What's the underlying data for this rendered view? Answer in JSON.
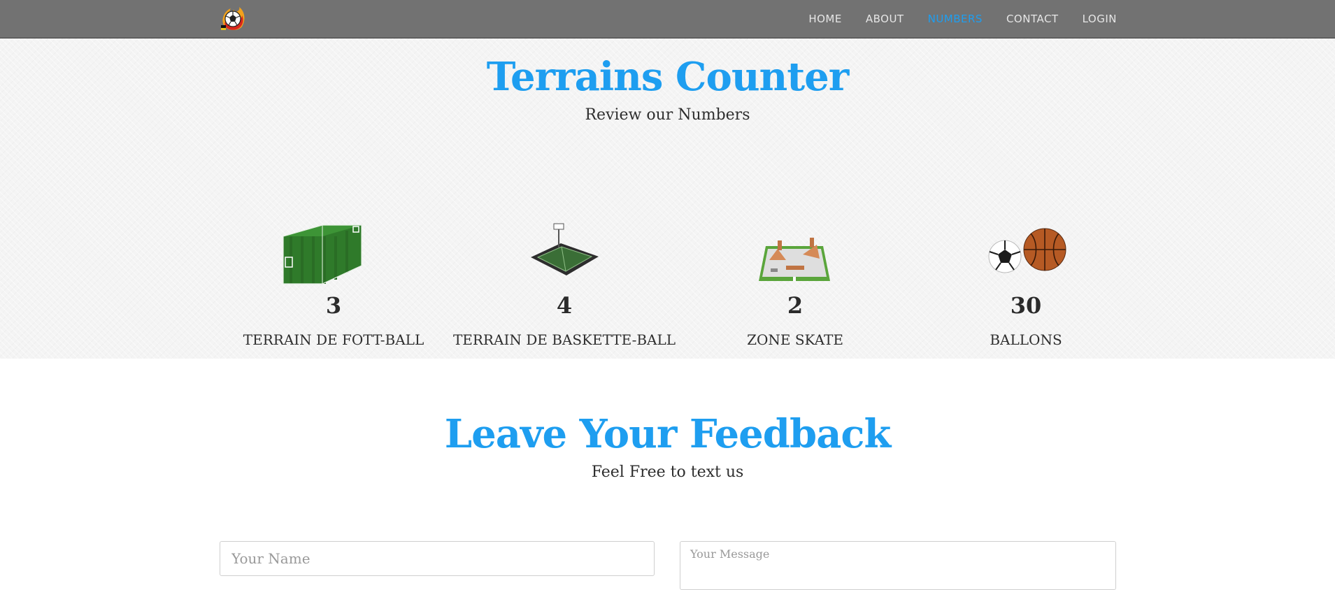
{
  "nav": {
    "logo_icon": "soccer-ball-flame-logo",
    "links": [
      {
        "label": "HOME",
        "active": false
      },
      {
        "label": "ABOUT",
        "active": false
      },
      {
        "label": "NUMBERS",
        "active": true
      },
      {
        "label": "CONTACT",
        "active": false
      },
      {
        "label": "LOGIN",
        "active": false
      }
    ]
  },
  "counter": {
    "title": "Terrains Counter",
    "subtitle": "Review our Numbers",
    "stats": [
      {
        "icon": "football-field-icon",
        "number": "3",
        "label": "TERRAIN DE FOTT-BALL"
      },
      {
        "icon": "basketball-court-icon",
        "number": "4",
        "label": "TERRAIN DE BASKETTE-BALL"
      },
      {
        "icon": "skate-park-icon",
        "number": "2",
        "label": "ZONE SKATE"
      },
      {
        "icon": "balls-icon",
        "number": "30",
        "label": "BALLONS"
      }
    ]
  },
  "feedback": {
    "title": "Leave Your Feedback",
    "subtitle": "Feel Free to text us",
    "name_placeholder": "Your Name",
    "message_placeholder": "Your Message"
  },
  "colors": {
    "accent": "#1e9ef0",
    "navbar": "#727272"
  }
}
